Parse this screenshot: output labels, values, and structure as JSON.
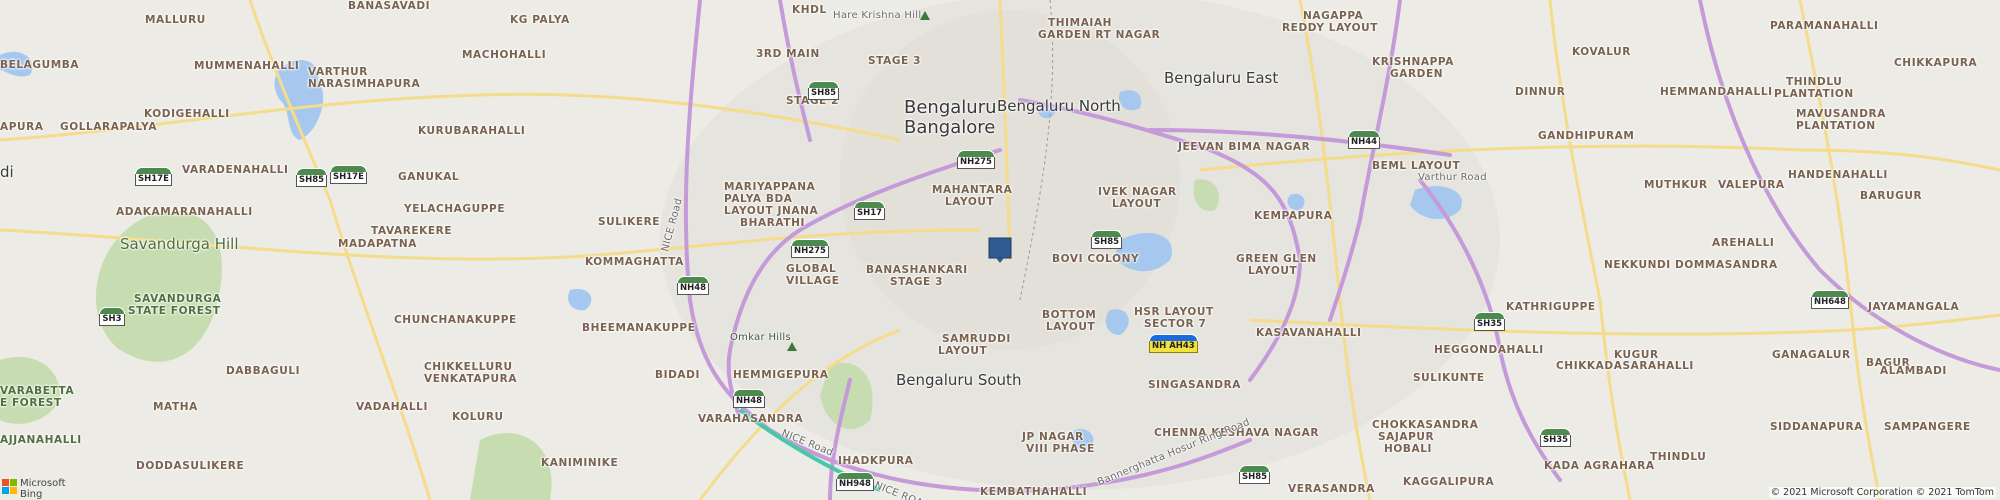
{
  "map": {
    "labels": {
      "malluru": "MALLURU",
      "banasavadi": "BANASAVADI",
      "kg_palya": "KG PALYA",
      "khdl": "KHDL",
      "hare_krishna_hill": "Hare Krishna Hill",
      "thimaiah_1": "THIMAIAH",
      "thimaiah_2": "GARDEN RT NAGAR",
      "nagappa_1": "NAGAPPA",
      "nagappa_2": "REDDY LAYOUT",
      "paramanahalli": "PARAMANAHALLI",
      "belagumba": "BELAGUMBA",
      "mummenahalli": "MUMMENAHALLI",
      "machohalli": "MACHOHALLI",
      "third_main": "3RD MAIN",
      "stage3_top": "STAGE 3",
      "krishnappa_1": "KRISHNAPPA",
      "krishnappa_2": "GARDEN",
      "kovalur": "KOVALUR",
      "chikkapura": "CHIKKAPURA",
      "varthur_1": "VARTHUR",
      "varthur_2": "NARASIMHAPURA",
      "stage2": "STAGE 2",
      "bengaluru": "Bengaluru",
      "bangalore": "Bangalore",
      "bengaluru_north": "Bengaluru North",
      "bengaluru_east": "Bengaluru East",
      "dinnur": "DINNUR",
      "thindlu_1": "THINDLU",
      "thindlu_2": "PLANTATION",
      "apura": "APURA",
      "kodigehalli": "KODIGEHALLI",
      "kurubarahalli": "KURUBARAHALLI",
      "gandhipuram": "GANDHIPURAM",
      "hemmandahalli": "HEMMANDAHALLI",
      "mavusandra_1": "MAVUSANDRA",
      "mavusandra_2": "PLANTATION",
      "gollarapalya": "GOLLARAPALYA",
      "jeevan_bima": "JEEVAN BIMA NAGAR",
      "beml_layout": "BEML LAYOUT",
      "varthur_road": "Varthur Road",
      "handenahalli": "HANDENAHALLI",
      "varadenahalli": "VARADENAHALLI",
      "ganukal": "GANUKAL",
      "mariyappana_1": "MARIYAPPANA",
      "mariyappana_2": "PALYA BDA",
      "mariyappana_3": "LAYOUT JNANA",
      "mariyappana_4": "BHARATHI",
      "mahantara_1": "MAHANTARA",
      "mahantara_2": "LAYOUT",
      "ivek_1": "IVEK NAGAR",
      "ivek_2": "LAYOUT",
      "muthkur": "MUTHKUR",
      "valepura": "VALEPURA",
      "adakamaranahalli": "ADAKAMARANAHALLI",
      "yelachaguppe": "YELACHAGUPPE",
      "barugur": "BARUGUR",
      "sulikere": "SULIKERE",
      "kempapura": "KEMPAPURA",
      "arehalli": "AREHALLI",
      "tavarekere": "TAVAREKERE",
      "madapatna": "MADAPATNA",
      "bovi_colony": "BOVI COLONY",
      "green_glen_1": "GREEN GLEN",
      "green_glen_2": "LAYOUT",
      "nekkundi": "NEKKUNDI DOMMASANDRA",
      "savandurga_hill": "Savandurga Hill",
      "kommaghatta": "KOMMAGHATTA",
      "global_1": "GLOBAL",
      "global_2": "VILLAGE",
      "banashankari_1": "BANASHANKARI",
      "banashankari_2": "STAGE 3",
      "savandurga_forest_1": "SAVANDURGA",
      "savandurga_forest_2": "STATE FOREST",
      "nice_road": "NICE Road",
      "bottom_1": "BOTTOM",
      "bottom_2": "LAYOUT",
      "hsr_1": "HSR LAYOUT",
      "hsr_2": "SECTOR 7",
      "kathriguppe": "KATHRIGUPPE",
      "jayamangala": "JAYAMANGALA",
      "chunchanakuppe": "CHUNCHANAKUPPE",
      "bheemanakuppe": "BHEEMANAKUPPE",
      "omkar_hills": "Omkar Hills",
      "samruddi_1": "SAMRUDDI",
      "samruddi_2": "LAYOUT",
      "kasavanahalli": "KASAVANAHALLI",
      "heggondahalli": "HEGGONDAHALLI",
      "kugur": "KUGUR",
      "ganagalur": "GANAGALUR",
      "dabbaguli": "DABBAGULI",
      "chikkelluru_1": "CHIKKELLURU",
      "chikkelluru_2": "VENKATAPURA",
      "bidadi": "BIDADI",
      "hemmigepura": "HEMMIGEPURA",
      "bengaluru_south": "Bengaluru South",
      "singasandra": "SINGASANDRA",
      "sulikunte": "SULIKUNTE",
      "chikkadasarahalli": "CHIKKADASARAHALLI",
      "bagur": "BAGUR",
      "alambadi": "ALAMBADI",
      "vabetta_1": "VARABETTA",
      "vabetta_2": "E FOREST",
      "matha": "MATHA",
      "vadahalli": "VADAHALLI",
      "koluru": "KOLURU",
      "varahasandra": "VARAHASANDRA",
      "chenna_keshava": "CHENNA KESHAVA NAGAR",
      "chokkasandra_1": "CHOKKASANDRA",
      "chokkasandra_2": "SAJAPUR",
      "chokkasandra_3": "HOBALI",
      "siddanapura": "SIDDANAPURA",
      "sampangere": "SAMPANGERE",
      "ajjanahalli": "AJJANAHALLI",
      "doddasulikere": "DODDASULIKERE",
      "kanimintke": "KANIMINIKE",
      "nice_road_2": "NICE Road",
      "ihadkpura": "IHADKPURA",
      "jp_nagar_1": "JP NAGAR",
      "jp_nagar_2": "VIII PHASE",
      "bannerghatta_road": "Bannerghatta Hosur Ring Road",
      "kada_agrahara": "KADA AGRAHARA",
      "thindlu_s": "THINDLU",
      "kembathahalli": "KEMBATHAHALLI",
      "verasandra": "VERASANDRA",
      "kaggalipura": "KAGGALIPURA",
      "nice_road_3": "NICE ROAD",
      "di": "di"
    },
    "shields": {
      "sh85_a": "SH85",
      "nh275_a": "NH275",
      "nh44": "NH44",
      "sh17e_a": "SH17E",
      "sh85_b": "SH85",
      "sh17e_b": "SH17E",
      "sh17": "SH17",
      "nh275_b": "NH275",
      "sh85_c": "SH85",
      "nh48_a": "NH48",
      "sh3": "SH3",
      "nh_ah43_1": "NH",
      "nh_ah43_2": "AH43",
      "sh35_a": "SH35",
      "nh648": "NH648",
      "nh48_b": "NH48",
      "sh35_b": "SH35",
      "nh948": "NH948",
      "sh85_d": "SH85"
    },
    "pin_color": "#2f5b93",
    "colors": {
      "highway": "#c49ad8",
      "arterial": "#f4dc8a",
      "water": "#a6c8ef",
      "green": "#c6ddb0",
      "urban": "#e4e2dc"
    }
  },
  "brand": {
    "logo_line1": "Microsoft",
    "logo_line2": "Bing",
    "square_colors": [
      "#f25022",
      "#7fba00",
      "#00a4ef",
      "#ffb900"
    ]
  },
  "copyright": "© 2021 Microsoft Corporation © 2021 TomTom"
}
